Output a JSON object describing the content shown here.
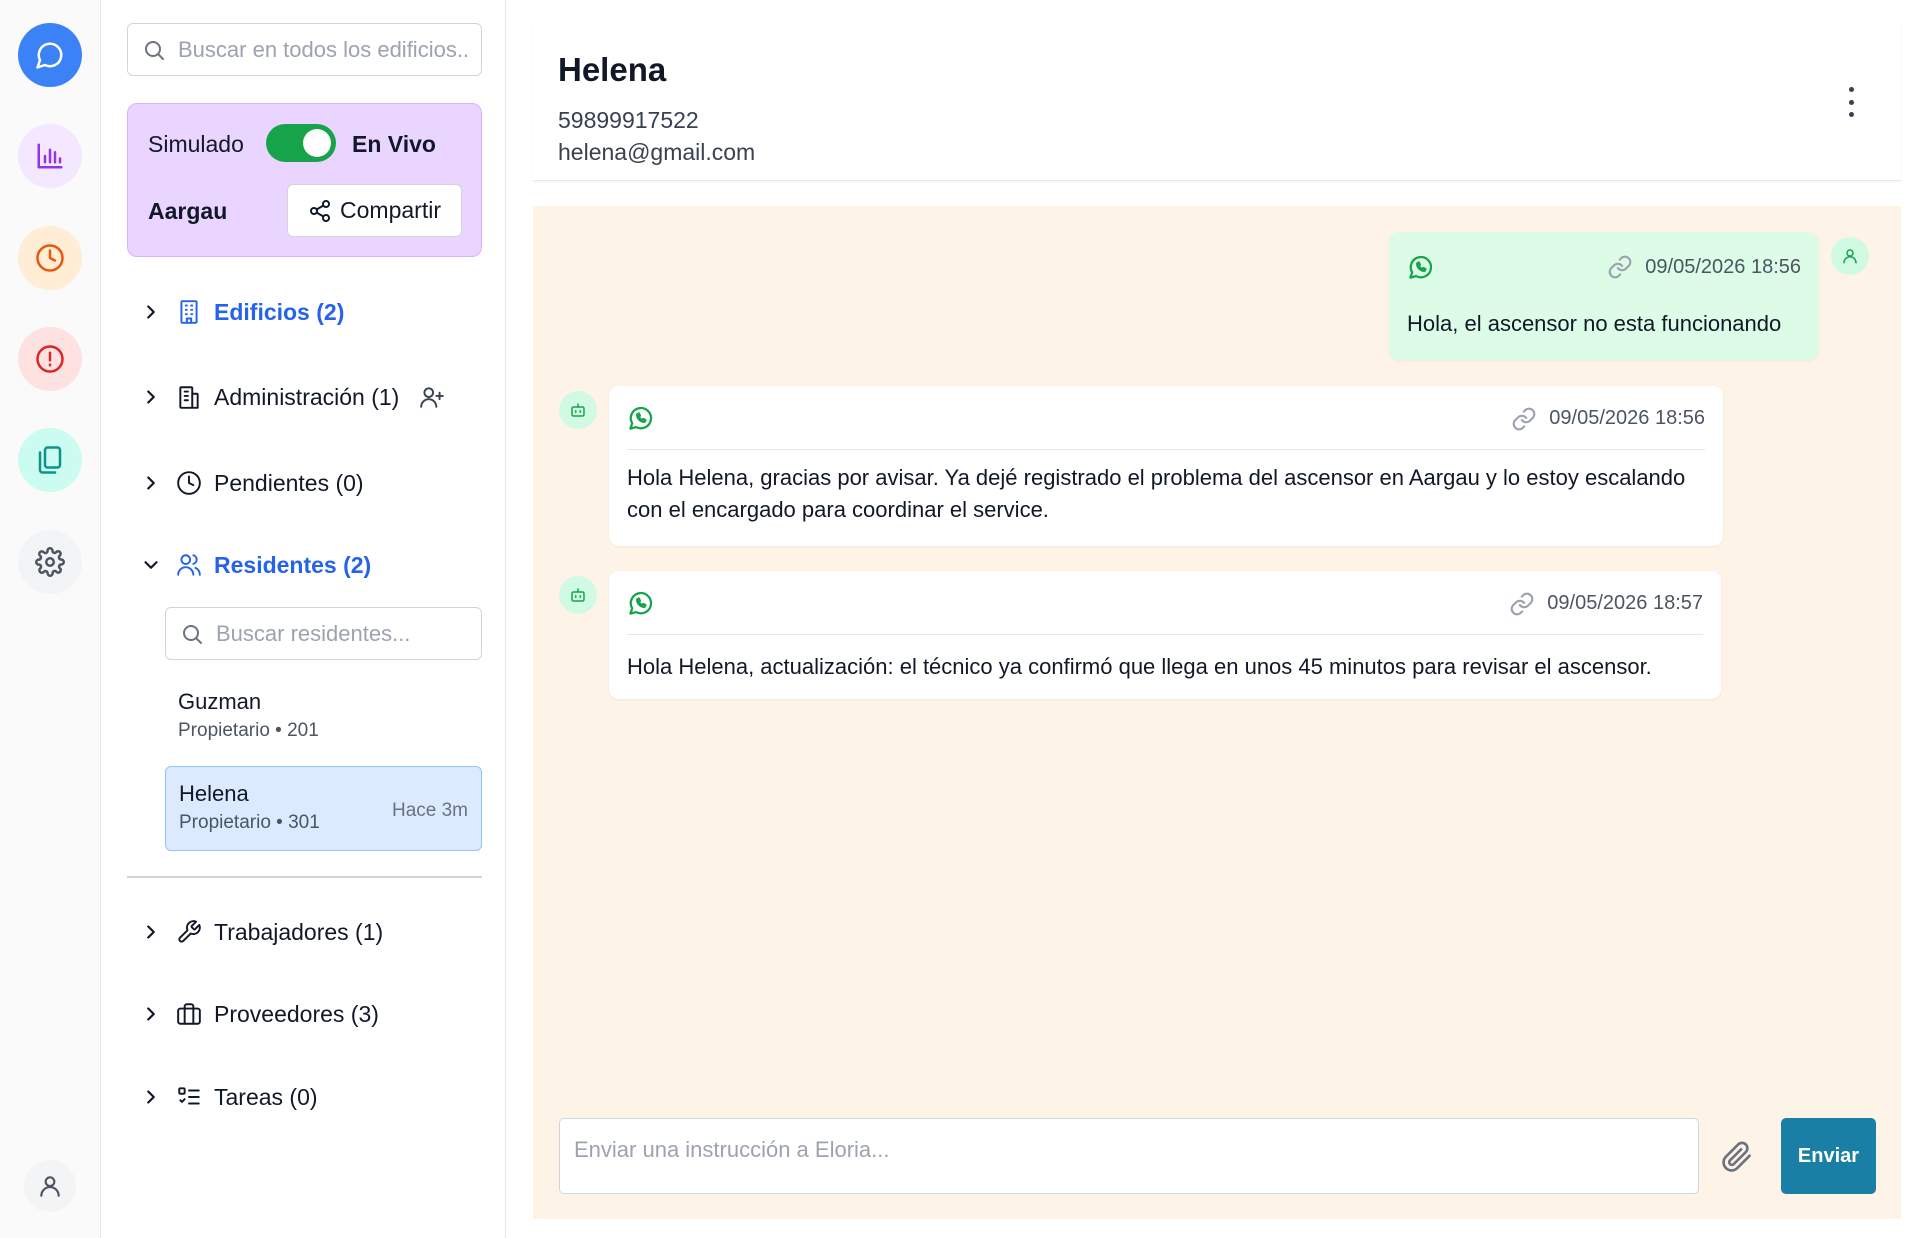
{
  "rail": {
    "items": [
      {
        "icon": "chat-icon",
        "bg": "#3b82f6",
        "stroke": "#ffffff"
      },
      {
        "icon": "bar-chart-icon",
        "bg": "#f3e8ff",
        "stroke": "#9333ea"
      },
      {
        "icon": "clock-icon",
        "bg": "#ffedd5",
        "stroke": "#ea580c"
      },
      {
        "icon": "alert-icon",
        "bg": "#fee2e2",
        "stroke": "#dc2626"
      },
      {
        "icon": "documents-icon",
        "bg": "#ccfbf1",
        "stroke": "#0d9488"
      },
      {
        "icon": "gear-icon",
        "bg": "#f3f4f6",
        "stroke": "#4b5563"
      }
    ],
    "profile_icon": "user-icon"
  },
  "side": {
    "search_placeholder": "Buscar en todos los edificios...",
    "mode": {
      "simulated_label": "Simulado",
      "live_label": "En Vivo",
      "building": "Aargau",
      "share_label": "Compartir"
    },
    "sections": {
      "buildings": "Edificios (2)",
      "administration": "Administración (1)",
      "pending": "Pendientes (0)",
      "residents": "Residentes (2)",
      "workers": "Trabajadores (1)",
      "providers": "Proveedores (3)",
      "tasks": "Tareas (0)"
    },
    "residents_search_placeholder": "Buscar residentes...",
    "residents": [
      {
        "name": "Guzman",
        "meta": "Propietario • 201",
        "time": ""
      },
      {
        "name": "Helena",
        "meta": "Propietario • 301",
        "time": "Hace 3m"
      }
    ]
  },
  "header": {
    "name": "Helena",
    "phone": "59899917522",
    "email": "helena@gmail.com"
  },
  "messages": [
    {
      "from": "user",
      "timestamp": "09/05/2026 18:56",
      "text": "Hola, el ascensor no esta funcionando"
    },
    {
      "from": "bot",
      "timestamp": "09/05/2026 18:56",
      "text": "Hola Helena, gracias por avisar. Ya dejé registrado el problema del ascensor en Aargau y lo estoy escalando con el encargado para coordinar el service."
    },
    {
      "from": "bot",
      "timestamp": "09/05/2026 18:57",
      "text": "Hola Helena, actualización: el técnico ya confirmó que llega en unos 45 minutos para revisar el ascensor."
    }
  ],
  "composer": {
    "placeholder": "Enviar una instrucción a Eloria...",
    "send_label": "Enviar"
  },
  "colors": {
    "accent": "#2563eb",
    "send": "#1a7fa5",
    "toggle_on": "#16a34a",
    "chat_bg": "#fef3e7",
    "user_bubble": "#dcfce7",
    "mode_card": "#e9d5ff"
  }
}
